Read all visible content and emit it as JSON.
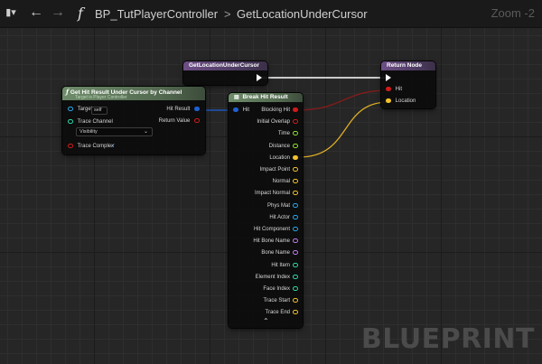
{
  "topbar": {
    "history_icon": "▮▾",
    "back_icon": "←",
    "forward_icon": "→",
    "function_glyph": "f",
    "blueprint_name": "BP_TutPlayerController",
    "separator": ">",
    "function_name": "GetLocationUnderCursor",
    "zoom": "Zoom -2"
  },
  "watermark": "BLUEPRINT",
  "nodes": {
    "entry": {
      "title": "GetLocationUnderCursor"
    },
    "return": {
      "title": "Return Node",
      "pins": [
        "Hit",
        "Location"
      ]
    },
    "hit_result": {
      "title": "Get Hit Result Under Cursor by Channel",
      "subtitle": "Target is Player Controller",
      "target_label": "Target",
      "target_value": "self",
      "trace_channel_label": "Trace Channel",
      "trace_channel_value": "Visibility",
      "trace_complex_label": "Trace Complex",
      "trace_complex_checked": true,
      "out_hit_result": "Hit Result",
      "out_return_value": "Return Value"
    },
    "break_hit": {
      "title": "Break Hit Result",
      "input_label": "Hit",
      "outputs": [
        {
          "label": "Blocking Hit",
          "color": "#d11a1a",
          "hollow": false
        },
        {
          "label": "Initial Overlap",
          "color": "#d11a1a",
          "hollow": true
        },
        {
          "label": "Time",
          "color": "#8de02c",
          "hollow": true
        },
        {
          "label": "Distance",
          "color": "#8de02c",
          "hollow": true
        },
        {
          "label": "Location",
          "color": "#f2c12e",
          "hollow": false
        },
        {
          "label": "Impact Point",
          "color": "#f2c12e",
          "hollow": true
        },
        {
          "label": "Normal",
          "color": "#f2c12e",
          "hollow": true
        },
        {
          "label": "Impact Normal",
          "color": "#f2c12e",
          "hollow": true
        },
        {
          "label": "Phys Mat",
          "color": "#2aa5e8",
          "hollow": true
        },
        {
          "label": "Hit Actor",
          "color": "#2aa5e8",
          "hollow": true
        },
        {
          "label": "Hit Component",
          "color": "#2aa5e8",
          "hollow": true
        },
        {
          "label": "Hit Bone Name",
          "color": "#c07bef",
          "hollow": true
        },
        {
          "label": "Bone Name",
          "color": "#c07bef",
          "hollow": true
        },
        {
          "label": "Hit Item",
          "color": "#2fd6a8",
          "hollow": true
        },
        {
          "label": "Element Index",
          "color": "#2fd6a8",
          "hollow": true
        },
        {
          "label": "Face Index",
          "color": "#2fd6a8",
          "hollow": true
        },
        {
          "label": "Trace Start",
          "color": "#f2c12e",
          "hollow": true
        },
        {
          "label": "Trace End",
          "color": "#f2c12e",
          "hollow": true
        }
      ],
      "expand_icon": "chevron-up-icon"
    }
  },
  "colors": {
    "exec": "#ffffff",
    "boolean": "#d11a1a",
    "vector": "#f2c12e",
    "object": "#2aa5e8",
    "struct": "#1f61d4",
    "byte": "#2fd6a8"
  }
}
